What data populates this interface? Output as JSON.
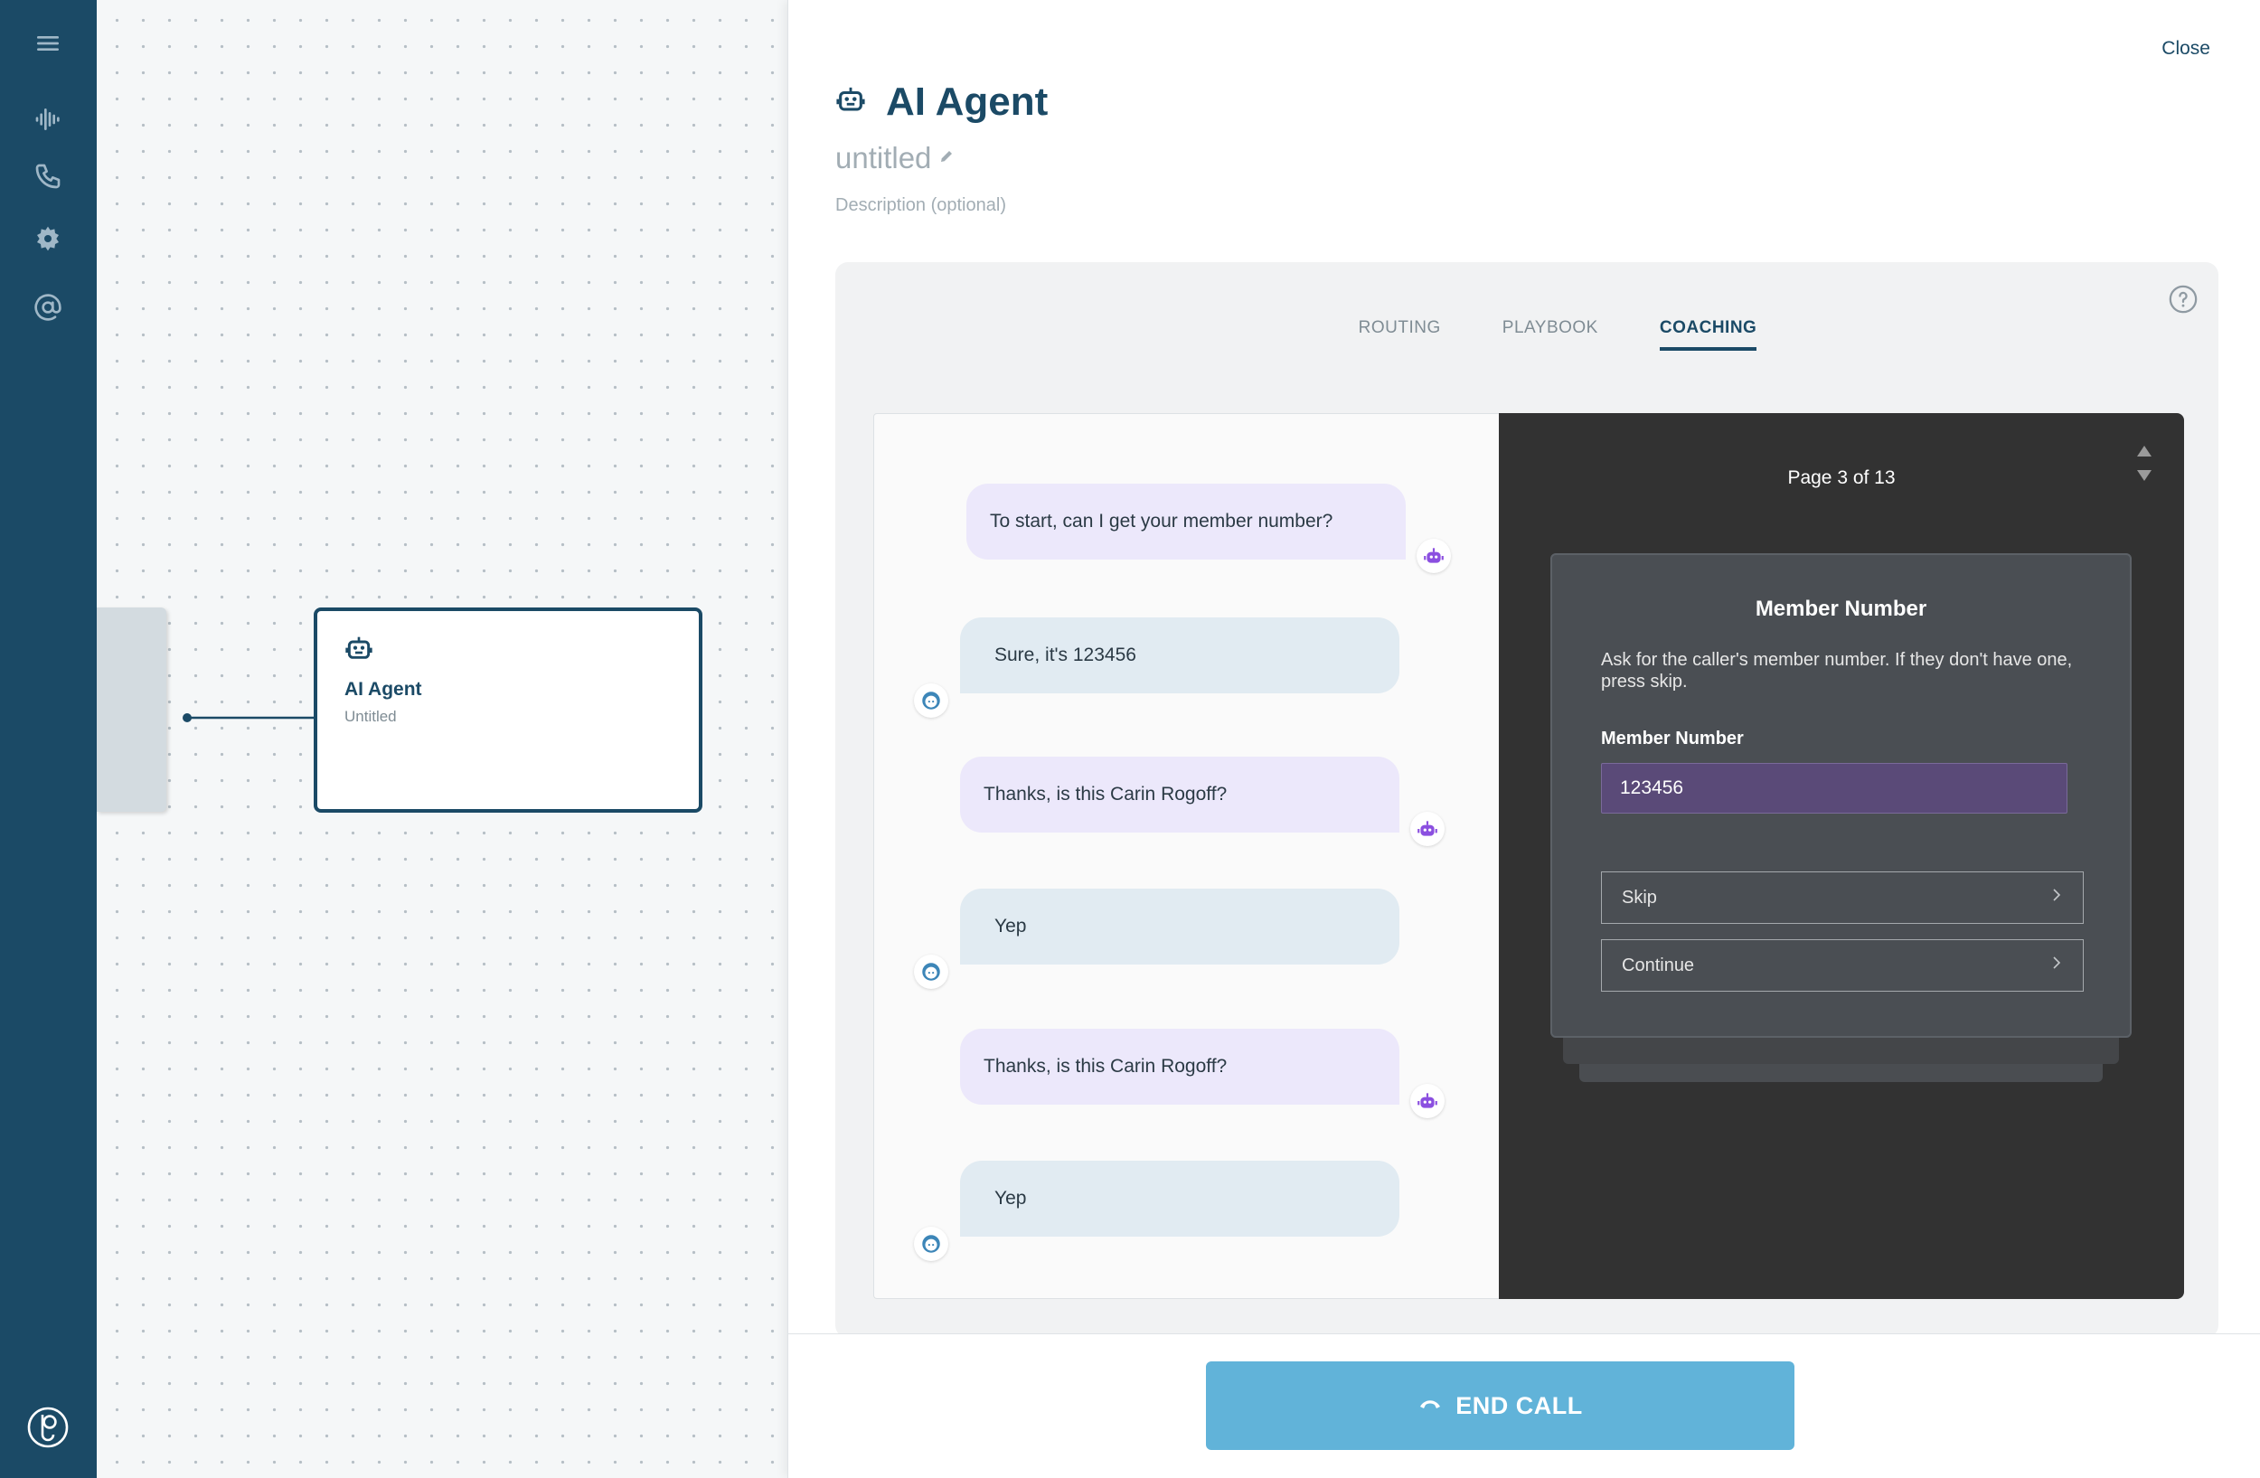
{
  "sidebar": {
    "icons": [
      "menu-icon",
      "waveform-icon",
      "phone-icon",
      "gear-icon",
      "at-sign-icon",
      "logo-icon"
    ]
  },
  "canvas": {
    "node": {
      "title": "AI Agent",
      "subtitle": "Untitled",
      "icon": "robot-icon"
    }
  },
  "panel": {
    "close_label": "Close",
    "title": "AI Agent",
    "subtitle": "untitled",
    "description_placeholder": "Description (optional)",
    "tabs": [
      {
        "label": "ROUTING",
        "active": false
      },
      {
        "label": "PLAYBOOK",
        "active": false
      },
      {
        "label": "COACHING",
        "active": true
      }
    ],
    "chat": [
      {
        "role": "bot",
        "text": "To start, can I get your member number?"
      },
      {
        "role": "user",
        "text": "Sure, it's 123456"
      },
      {
        "role": "bot",
        "text": "Thanks, is this Carin Rogoff?"
      },
      {
        "role": "user",
        "text": "Yep"
      },
      {
        "role": "bot",
        "text": "Thanks, is this Carin Rogoff?"
      },
      {
        "role": "user",
        "text": "Yep"
      }
    ],
    "coaching": {
      "page_label": "Page 3 of 13",
      "step_title": "Member Number",
      "step_description": "Ask for the caller's member number. If they don't have one, press skip.",
      "field_label": "Member Number",
      "field_value": "123456",
      "skip_label": "Skip",
      "continue_label": "Continue"
    },
    "end_call_label": "END CALL"
  },
  "colors": {
    "sidebar": "#1b4a66",
    "accent": "#1b4a66",
    "end_call": "#61b3d9",
    "bot_bubble": "#ece8fb",
    "user_bubble": "#e1ebf2",
    "coach_bg": "#323232",
    "bot_avatar": "#8b4fe0",
    "user_avatar": "#3d86b8"
  }
}
